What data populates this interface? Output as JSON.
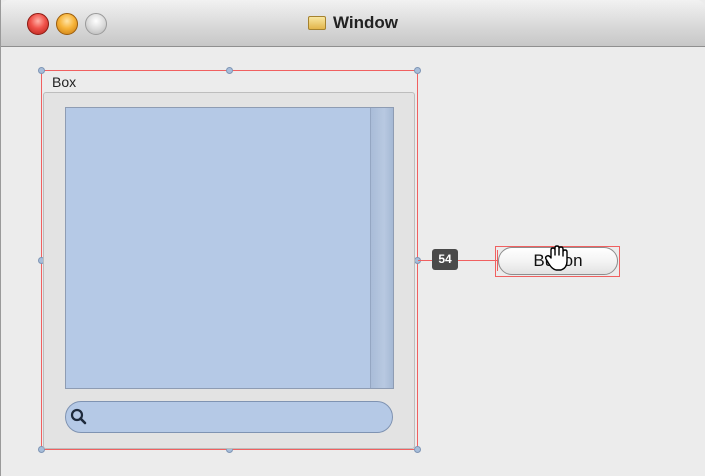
{
  "window": {
    "title": "Window"
  },
  "box": {
    "title": "Box"
  },
  "search": {
    "placeholder": "",
    "value": ""
  },
  "constraint": {
    "distance_label": "54"
  },
  "button": {
    "label": "Button"
  },
  "icons": [
    "close-button",
    "minimize-button",
    "zoom-button",
    "window-icon",
    "search-icon",
    "hand-cursor-icon"
  ]
}
